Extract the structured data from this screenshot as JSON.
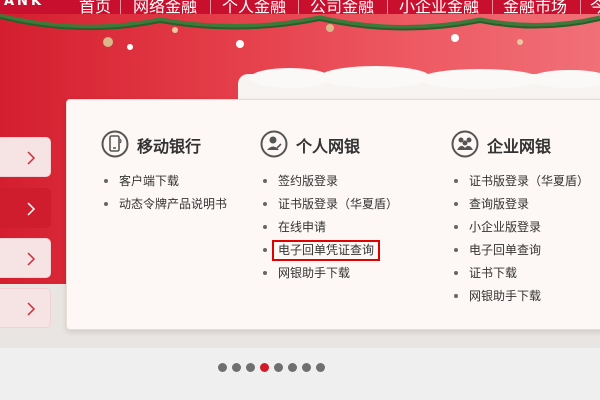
{
  "header": {
    "logo_text": "ANK",
    "nav": [
      {
        "label": "首页"
      },
      {
        "label": "网络金融"
      },
      {
        "label": "个人金融"
      },
      {
        "label": "公司金融"
      },
      {
        "label": "小企业金融"
      },
      {
        "label": "金融市场"
      },
      {
        "label": "今"
      }
    ]
  },
  "side_tabs": [
    {
      "icon": "chevron-right-icon",
      "active": false
    },
    {
      "icon": "chevron-right-icon",
      "active": true
    },
    {
      "icon": "chevron-right-icon",
      "active": false
    },
    {
      "icon": "chevron-right-icon",
      "active": false
    }
  ],
  "panel": {
    "columns": [
      {
        "title": "移动银行",
        "icon": "mobile-banking-icon",
        "links": [
          "客户端下载",
          "动态令牌产品说明书"
        ]
      },
      {
        "title": "个人网银",
        "icon": "personal-banking-icon",
        "links": [
          "签约版登录",
          "证书版登录（华夏盾）",
          "在线申请",
          "电子回单凭证查询",
          "网银助手下载"
        ],
        "highlighted_index": 3
      },
      {
        "title": "企业网银",
        "icon": "corporate-banking-icon",
        "links": [
          "证书版登录（华夏盾）",
          "查询版登录",
          "小企业版登录",
          "电子回单查询",
          "证书下载",
          "网银助手下载"
        ]
      }
    ]
  },
  "carousel": {
    "slide_count": 8,
    "active_index": 3
  },
  "colors": {
    "brand_red": "#c8102e",
    "highlight_border": "#e00000",
    "panel_bg": "#fdf8f5"
  }
}
